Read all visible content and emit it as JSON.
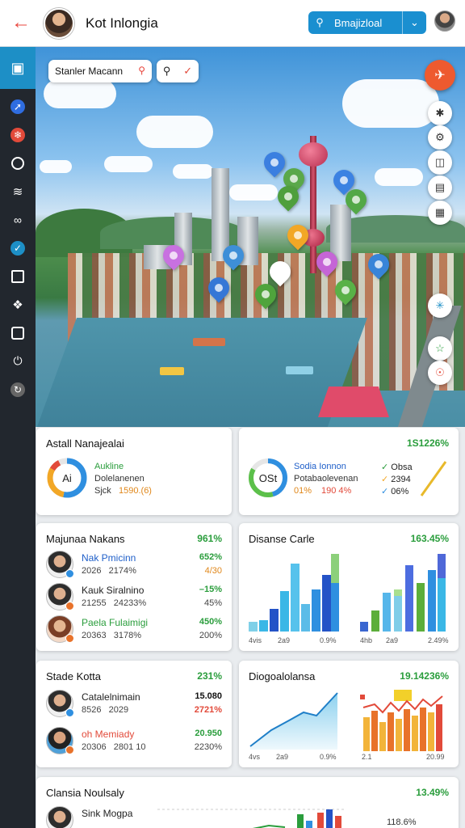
{
  "header": {
    "title": "Kot Inlongia",
    "search_text": "Bmajizloal",
    "back_icon": "arrow-left-icon",
    "accent": "#1a8fd0"
  },
  "sidebar": {
    "items": [
      {
        "icon": "dashboard-icon",
        "color": "#1d8fc6"
      },
      {
        "icon": "compass-icon",
        "color": "#2f6de0"
      },
      {
        "icon": "flame-icon",
        "color": "#e24a3a"
      },
      {
        "icon": "user-icon",
        "color": "#22272e"
      },
      {
        "icon": "wifi-icon",
        "color": "#22272e"
      },
      {
        "icon": "link-icon",
        "color": "#22272e"
      },
      {
        "icon": "pin-icon",
        "color": "#1d8fc6"
      },
      {
        "icon": "building-icon",
        "color": "#22272e"
      },
      {
        "icon": "nodes-icon",
        "color": "#22272e"
      },
      {
        "icon": "layers-icon",
        "color": "#22272e"
      },
      {
        "icon": "power-icon",
        "color": "#22272e"
      },
      {
        "icon": "refresh-icon",
        "color": "#666"
      }
    ]
  },
  "map": {
    "search_text": "Stanler Macann",
    "tools": [
      "route-icon",
      "settings-icon",
      "layers-icon",
      "document-icon",
      "grid-icon",
      "satellite-icon",
      "star-icon",
      "compass-icon"
    ]
  },
  "cards": {
    "analysis": {
      "title": "Astall Nanajealai",
      "donut_label": "Ai",
      "line1": "Aukline",
      "line2": "Dolelanenen",
      "line3_a": "Sjck",
      "line3_b": "1590.(6)"
    },
    "overview": {
      "value": "1S1226%",
      "donut_label": "OSt",
      "line1": "Sodia Ionnon",
      "line2": "Potabaolevenan",
      "stat_a": "01%",
      "stat_b": "190 4%",
      "legend": [
        "Obsa",
        "2394",
        "06%"
      ]
    },
    "members": {
      "title": "Majunaa Nakans",
      "value": "961%",
      "rows": [
        {
          "name": "Nak Pmicinn",
          "sub_a": "2026",
          "sub_b": "2174%",
          "v1": "652%",
          "v2": "4/30",
          "name_color": "#1f5fc9",
          "v1_color": "#2a9d3c",
          "v2_color": "#e0871a"
        },
        {
          "name": "Kauk Siralnino",
          "sub_a": "21255",
          "sub_b": "24233%",
          "v1": "–15%",
          "v2": "45%",
          "name_color": "#111",
          "v1_color": "#2a9d3c",
          "v2_color": "#444"
        },
        {
          "name": "Paela Fulaimigi",
          "sub_a": "20363",
          "sub_b": "3178%",
          "v1": "450%",
          "v2": "200%",
          "name_color": "#2a9d3c",
          "v1_color": "#2a9d3c",
          "v2_color": "#444"
        }
      ]
    },
    "distance": {
      "title": "Disanse Carle",
      "value": "163.45%",
      "axis": [
        "4vis",
        "2a9",
        "0.9%"
      ],
      "axis2": [
        "4hb",
        "2a9",
        "2.49%"
      ]
    },
    "state": {
      "title": "Stade Kotta",
      "value": "231%",
      "rows": [
        {
          "name": "Catalelnimain",
          "sub_a": "8526",
          "sub_b": "2029",
          "v1": "15.080",
          "v2": "2721%",
          "name_color": "#111",
          "v1_color": "#111",
          "v2_color": "#e24a3a"
        },
        {
          "name": "oh Memiady",
          "sub_a": "20306",
          "sub_b": "2801 10",
          "v1": "20.950",
          "v2": "2230%",
          "name_color": "#e24a3a",
          "v1_color": "#2a9d3c",
          "v2_color": "#444"
        }
      ]
    },
    "dialog": {
      "title": "Diogoalolansa",
      "value": "19.14236%",
      "axis": [
        "4vs",
        "2a9",
        "0.9%"
      ],
      "axis2": [
        "2.1",
        "20.99"
      ]
    },
    "bottom": {
      "title": "Clansia Noulsaly",
      "value": "13.49%",
      "row_name": "Sink Mogpa",
      "row_value": "118.6%"
    }
  }
}
